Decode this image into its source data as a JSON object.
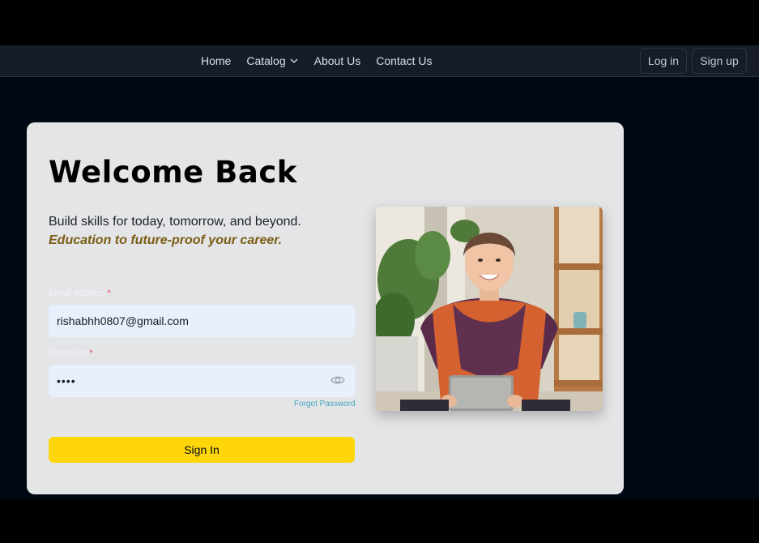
{
  "nav": {
    "links": [
      {
        "label": "Home"
      },
      {
        "label": "Catalog"
      },
      {
        "label": "About Us"
      },
      {
        "label": "Contact Us"
      }
    ],
    "login_label": "Log in",
    "signup_label": "Sign up"
  },
  "login": {
    "title": "Welcome Back",
    "subtitle": "Build skills for today, tomorrow, and beyond.",
    "tagline": "Education to future-proof your career.",
    "email_label": "Email Address",
    "email_value": "rishabhh0807@gmail.com",
    "password_label": "Password",
    "password_value": "••••",
    "required_mark": "*",
    "forgot_label": "Forgot Password",
    "signin_label": "Sign In"
  },
  "colors": {
    "accent": "#ffd60a",
    "page_bg": "#000814",
    "card_bg": "#e4e5e7",
    "link": "#47a5c5",
    "tagline": "#7a5c14"
  },
  "icons": [
    "chevron-down-icon",
    "eye-icon"
  ]
}
